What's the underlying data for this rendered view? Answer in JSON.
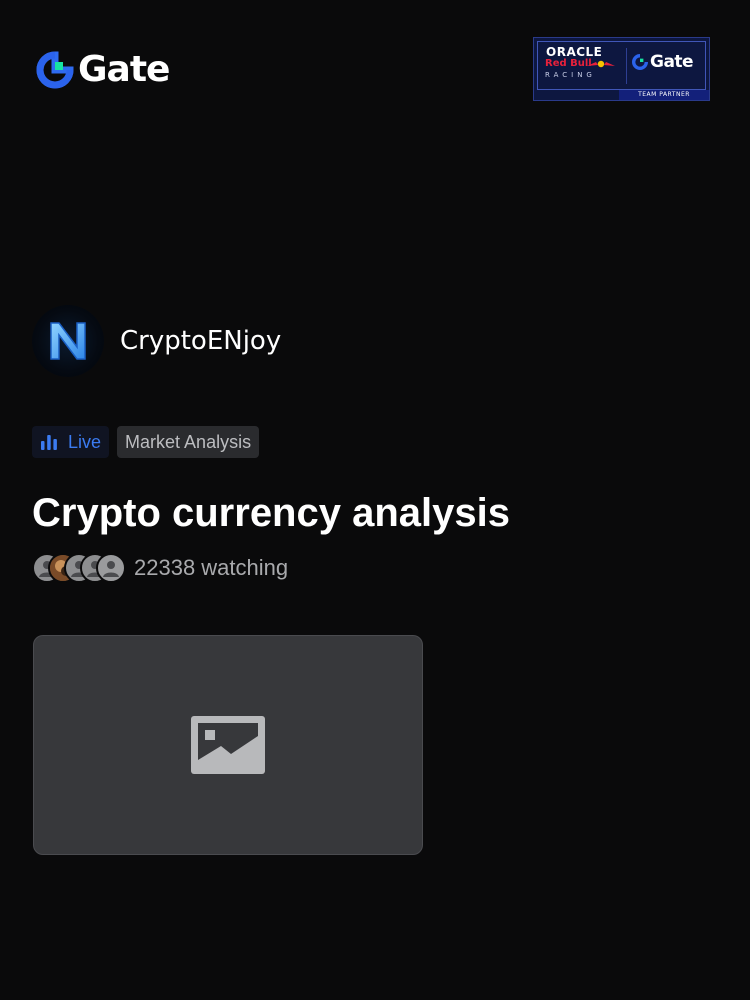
{
  "header": {
    "brand_name": "Gate",
    "partner_badge": {
      "line1": "ORACLE",
      "line2": "Red Bull",
      "line3": "RACING",
      "brand": "Gate",
      "footer": "TEAM PARTNER"
    }
  },
  "creator": {
    "name": "CryptoENjoy",
    "avatar_icon": "letter-n-avatar"
  },
  "tags": {
    "live_label": "Live",
    "category_label": "Market Analysis"
  },
  "stream": {
    "title": "Crypto currency analysis",
    "viewers_text": "22338 watching"
  },
  "thumbnail": {
    "icon": "image-placeholder-icon"
  },
  "colors": {
    "background": "#0a0a0b",
    "accent_blue": "#3b7bf0",
    "brand_green": "#17e3a1",
    "thumbnail_bg": "#37383b"
  }
}
